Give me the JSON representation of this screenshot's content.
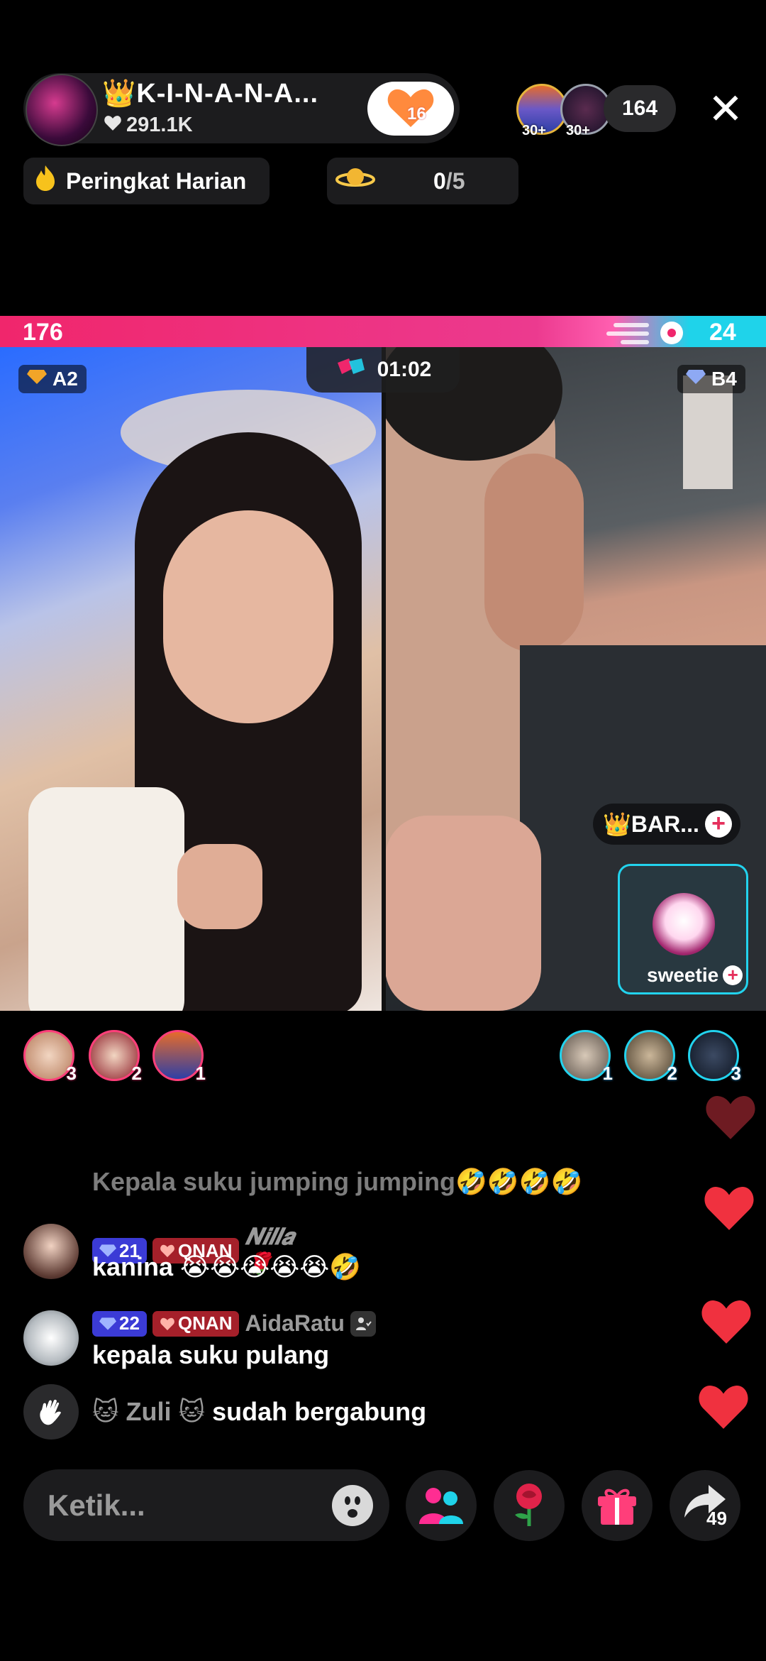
{
  "header": {
    "host_name": "👑K-I-N-A-N-A...",
    "host_likes": "291.1K",
    "follow_badge_count": "16",
    "viewer_rank_1": "30+",
    "viewer_rank_2": "30+",
    "viewer_count": "164",
    "close_symbol": "✕"
  },
  "chips": {
    "daily_rank": "Peringkat Harian",
    "planet_progress_done": "0",
    "planet_progress_total": "/5"
  },
  "battle": {
    "score_left": "176",
    "score_right": "24",
    "timer": "01:02",
    "left_rank": "A2",
    "right_rank": "B4",
    "opponent_name": "👑BAR...",
    "guest_name": "sweetie",
    "left_gifters": [
      "3",
      "2",
      "1"
    ],
    "right_gifters": [
      "1",
      "2",
      "3"
    ]
  },
  "chat": {
    "faded_message": "Kepala suku jumping jumping🤣🤣🤣🤣",
    "messages": [
      {
        "level": "21",
        "fan_badge": "QNAN",
        "username": "𝑵𝒊𝒍𝒍𝒂 🌹",
        "text": "kanina 😭😭😭😭😭🤣"
      },
      {
        "level": "22",
        "fan_badge": "QNAN",
        "username": "AidaRatu",
        "text": "kepala suku pulang"
      }
    ],
    "join": {
      "name": "🐱 Zuli 🐱",
      "text": "sudah bergabung"
    }
  },
  "bottom": {
    "input_placeholder": "Ketik...",
    "share_count": "49"
  },
  "colors": {
    "pink": "#f0266c",
    "cyan": "#22d3ee",
    "chip_bg": "#1c1c1e",
    "heart_red": "#f0313f"
  },
  "icons": [
    "crown-icon",
    "heart-icon",
    "close-icon",
    "fire-icon",
    "planet-icon",
    "battle-icon",
    "gem-icon",
    "plus-icon",
    "wave-icon",
    "emoji-icon",
    "people-icon",
    "rose-icon",
    "gift-icon",
    "share-icon"
  ]
}
